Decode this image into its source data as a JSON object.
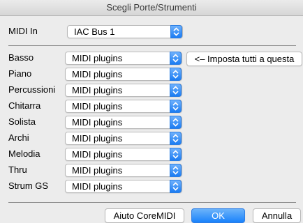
{
  "window": {
    "title": "Scegli Porte/Strumenti"
  },
  "midi_in": {
    "label": "MIDI In",
    "value": "IAC Bus 1"
  },
  "set_all_button": "<– Imposta tutti a questa",
  "rows": [
    {
      "label": "Basso",
      "value": "MIDI plugins"
    },
    {
      "label": "Piano",
      "value": "MIDI plugins"
    },
    {
      "label": "Percussioni",
      "value": "MIDI plugins"
    },
    {
      "label": "Chitarra",
      "value": "MIDI plugins"
    },
    {
      "label": "Solista",
      "value": "MIDI plugins"
    },
    {
      "label": "Archi",
      "value": "MIDI plugins"
    },
    {
      "label": "Melodia",
      "value": "MIDI plugins"
    },
    {
      "label": "Thru",
      "value": "MIDI plugins"
    },
    {
      "label": "Strum GS",
      "value": "MIDI plugins"
    }
  ],
  "footer": {
    "coremidi_help": "Aiuto CoreMIDI",
    "ok": "OK",
    "cancel": "Annulla"
  },
  "colors": {
    "accent": "#1a82fb"
  }
}
